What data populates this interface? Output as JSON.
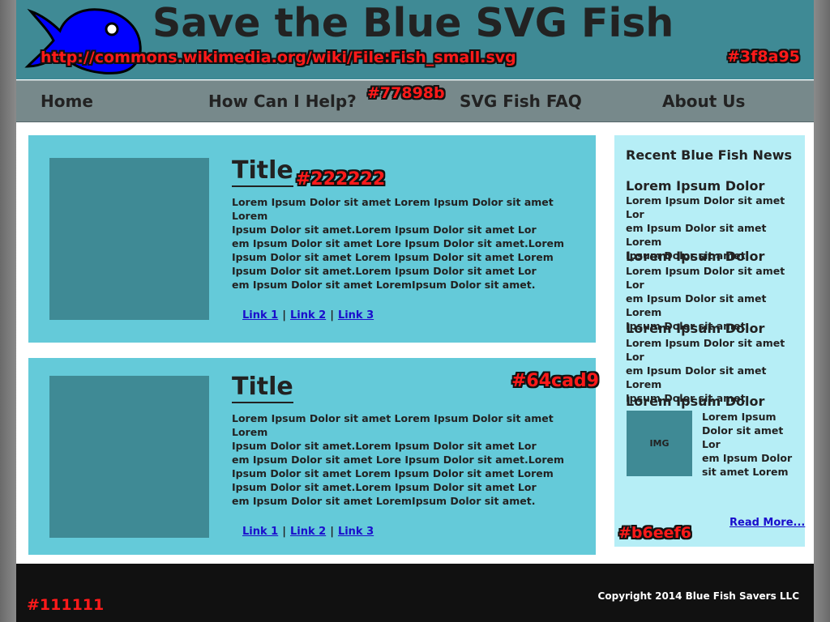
{
  "header": {
    "title": "Save the Blue SVG Fish",
    "source_url": "http://commons.wikimedia.org/wiki/File:Fish_small.svg",
    "color_label": "#3f8a95"
  },
  "nav": {
    "items": [
      "Home",
      "How Can I Help?",
      "SVG Fish FAQ",
      "About Us"
    ],
    "color_label": "#77898b"
  },
  "articles": [
    {
      "title": "Title",
      "title_color_label": "#222222",
      "lines": [
        "Lorem Ipsum Dolor sit amet Lorem Ipsum Dolor sit amet Lorem",
        "Ipsum Dolor sit amet.Lorem Ipsum Dolor sit amet Lor",
        "em Ipsum Dolor sit amet Lore Ipsum Dolor sit amet.Lorem",
        "Ipsum Dolor sit amet Lorem Ipsum Dolor sit amet Lorem",
        "Ipsum Dolor sit amet.Lorem Ipsum Dolor sit amet Lor",
        "em Ipsum Dolor sit amet LoremIpsum Dolor sit amet."
      ],
      "links": [
        "Link 1",
        "Link 2",
        "Link 3"
      ],
      "separator": "|"
    },
    {
      "title": "Title",
      "block_color_label": "#64cad9",
      "lines": [
        "Lorem Ipsum Dolor sit amet Lorem Ipsum Dolor sit amet Lorem",
        "Ipsum Dolor sit amet.Lorem Ipsum Dolor sit amet Lor",
        "em Ipsum Dolor sit amet Lore Ipsum Dolor sit amet.Lorem",
        "Ipsum Dolor sit amet Lorem Ipsum Dolor sit amet Lorem",
        "Ipsum Dolor sit amet.Lorem Ipsum Dolor sit amet Lor",
        "em Ipsum Dolor sit amet LoremIpsum Dolor sit amet."
      ],
      "links": [
        "Link 1",
        "Link 2",
        "Link 3"
      ],
      "separator": "|"
    }
  ],
  "sidebar": {
    "heading": "Recent Blue Fish News",
    "color_label": "#b6eef6",
    "news": [
      {
        "title": "Lorem Ipsum Dolor",
        "lines": [
          "Lorem Ipsum Dolor sit amet Lor",
          "em Ipsum Dolor sit amet Lorem",
          "Ipsum Dolor sit amet."
        ]
      },
      {
        "title": "Lorem Ipsum Dolor",
        "lines": [
          "Lorem Ipsum Dolor sit amet Lor",
          "em Ipsum Dolor sit amet Lorem",
          "Ipsum Dolor sit amet."
        ]
      },
      {
        "title": "Lorem Ipsum Dolor",
        "lines": [
          "Lorem Ipsum Dolor sit amet Lor",
          "em Ipsum Dolor sit amet Lorem",
          "Ipsum Dolor sit amet."
        ]
      },
      {
        "title": "Lorem Ipsum Dolor",
        "img_label": "IMG",
        "lines": [
          "Lorem Ipsum",
          "Dolor sit amet Lor",
          "em Ipsum Dolor",
          "sit amet Lorem"
        ]
      }
    ],
    "read_more": "Read More..."
  },
  "footer": {
    "copyright": "Copyright 2014 Blue Fish Savers LLC",
    "color_label": "#111111"
  },
  "colors": {
    "header": "#3f8a95",
    "nav": "#77898b",
    "text": "#222222",
    "article": "#64cad9",
    "sidebar": "#b6eef6",
    "footer": "#111111",
    "fish": "#0000ff"
  }
}
